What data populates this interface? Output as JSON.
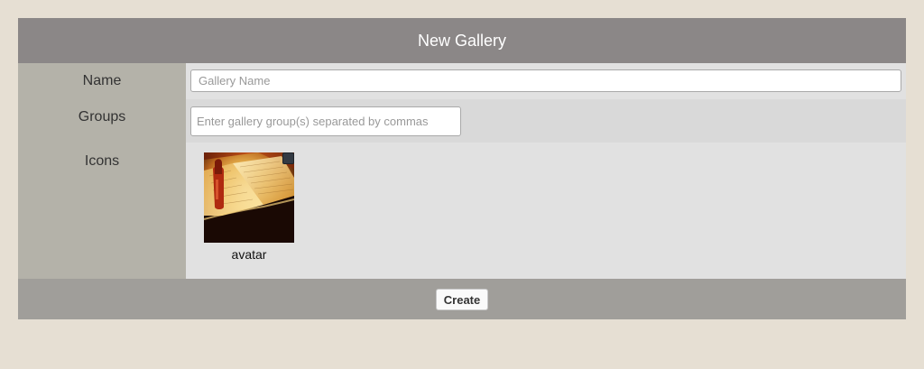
{
  "header": {
    "title": "New Gallery"
  },
  "form": {
    "name": {
      "label": "Name",
      "value": "",
      "placeholder": "Gallery Name"
    },
    "groups": {
      "label": "Groups",
      "value": "",
      "placeholder": "Enter gallery group(s) separated by commas"
    },
    "icons": {
      "label": "Icons",
      "items": [
        {
          "caption": "avatar",
          "image": "open-book-photo-icon",
          "checked": false
        }
      ]
    }
  },
  "footer": {
    "create_label": "Create"
  },
  "colors": {
    "page_background": "#e6dfd3",
    "header_background": "#8b8787",
    "label_column": "#b4b2a9",
    "footer_background": "#a09e9a"
  }
}
